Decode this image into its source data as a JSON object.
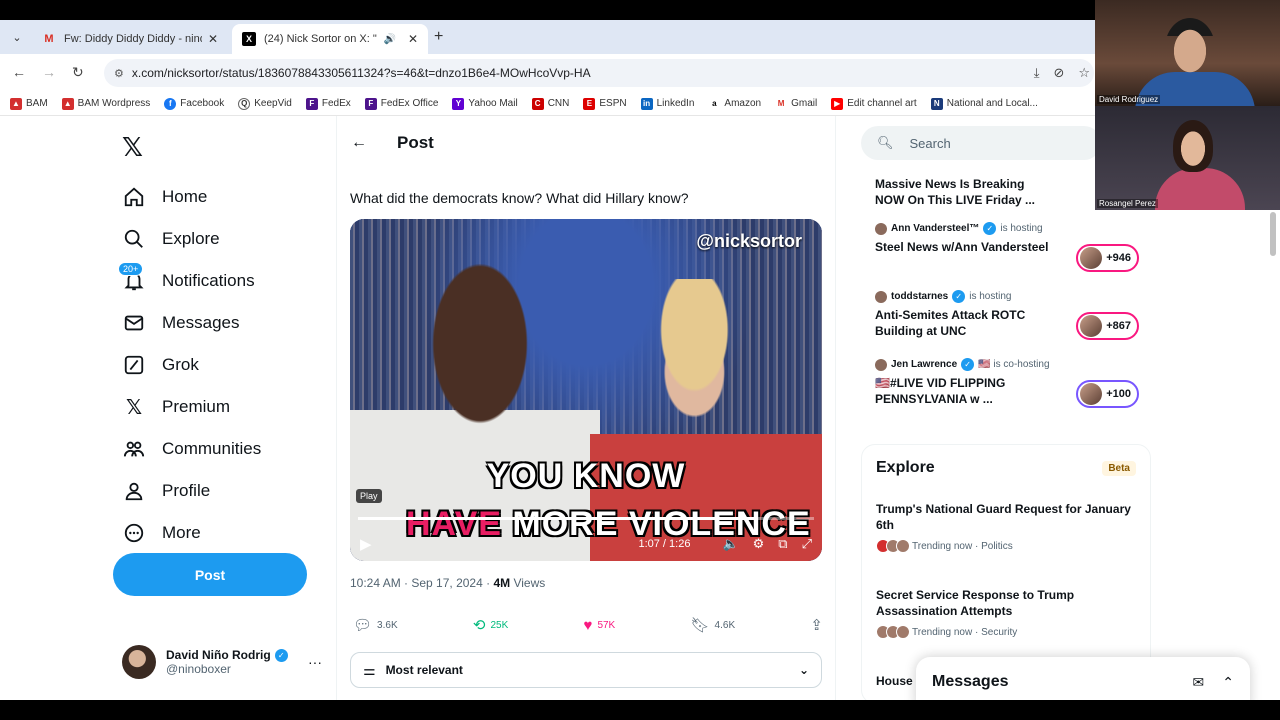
{
  "browser": {
    "tabs": [
      {
        "title": "Fw: Diddy Diddy Diddy - ninob",
        "favicon": "gmail-icon"
      },
      {
        "title": "(24) Nick Sortor on X: \"",
        "favicon": "x-icon"
      }
    ],
    "url": "x.com/nicksortor/status/1836078843305611324?s=46&t=dnzo1B6e4-MOwHcoVvp-HA",
    "bookmarks": [
      "BAM",
      "BAM Wordpress",
      "Facebook",
      "KeepVid",
      "FedEx",
      "FedEx Office",
      "Yahoo Mail",
      "CNN",
      "ESPN",
      "LinkedIn",
      "Amazon",
      "Gmail",
      "Edit channel art",
      "National and Local..."
    ]
  },
  "sidebar": {
    "items": [
      {
        "label": "Home",
        "icon": "home-icon"
      },
      {
        "label": "Explore",
        "icon": "search-icon"
      },
      {
        "label": "Notifications",
        "icon": "bell-icon",
        "badge": "20+"
      },
      {
        "label": "Messages",
        "icon": "mail-icon"
      },
      {
        "label": "Grok",
        "icon": "grok-icon"
      },
      {
        "label": "Premium",
        "icon": "x-icon"
      },
      {
        "label": "Communities",
        "icon": "communities-icon"
      },
      {
        "label": "Profile",
        "icon": "person-icon"
      },
      {
        "label": "More",
        "icon": "more-icon"
      }
    ],
    "post_button": "Post",
    "account": {
      "name": "David Niño Rodrig",
      "handle": "@ninoboxer"
    }
  },
  "post": {
    "header": "Post",
    "text": "What did the democrats know? What did Hillary know?",
    "video": {
      "watermark": "@nicksortor",
      "caption_line1": "YOU KNOW",
      "caption_highlight": "HAVE",
      "caption_line2": "MORE VIOLENCE",
      "tooltip": "Play",
      "time": "1:07 / 1:26",
      "progress": 0.87
    },
    "timestamp": "10:24 AM · Sep 17, 2024 · ",
    "views_count": "4M",
    "views_label": " Views",
    "actions": {
      "replies": "3.6K",
      "reposts": "25K",
      "likes": "57K",
      "bookmarks": "4.6K"
    },
    "sort_label": "Most relevant"
  },
  "right": {
    "search_placeholder": "Search",
    "spaces": [
      {
        "host": "",
        "status": "",
        "title": "Massive News Is Breaking NOW On This LIVE Friday ...",
        "count": ""
      },
      {
        "host": "Ann Vandersteel™",
        "status": "is hosting",
        "title": "Steel News w/Ann Vandersteel",
        "count": "+946"
      },
      {
        "host": "toddstarnes",
        "status": "is hosting",
        "title": "Anti-Semites Attack ROTC Building at UNC",
        "count": "+867"
      },
      {
        "host": "Jen Lawrence",
        "status": "🇺🇸 is co-hosting",
        "title": "🇺🇸#LIVE VID FLIPPING PENNSYLVANIA w ...",
        "count": "+100"
      }
    ],
    "explore": {
      "title": "Explore",
      "badge": "Beta",
      "trends": [
        {
          "title": "Trump's National Guard Request for January 6th",
          "meta": "Trending now · Politics"
        },
        {
          "title": "Secret Service Response to Trump Assassination Attempts",
          "meta": "Trending now · Security"
        },
        {
          "title": "House"
        }
      ]
    },
    "messages_drawer": "Messages"
  },
  "webcams": [
    {
      "label": "David Rodriguez"
    },
    {
      "label": "Rosangel Perez"
    }
  ]
}
